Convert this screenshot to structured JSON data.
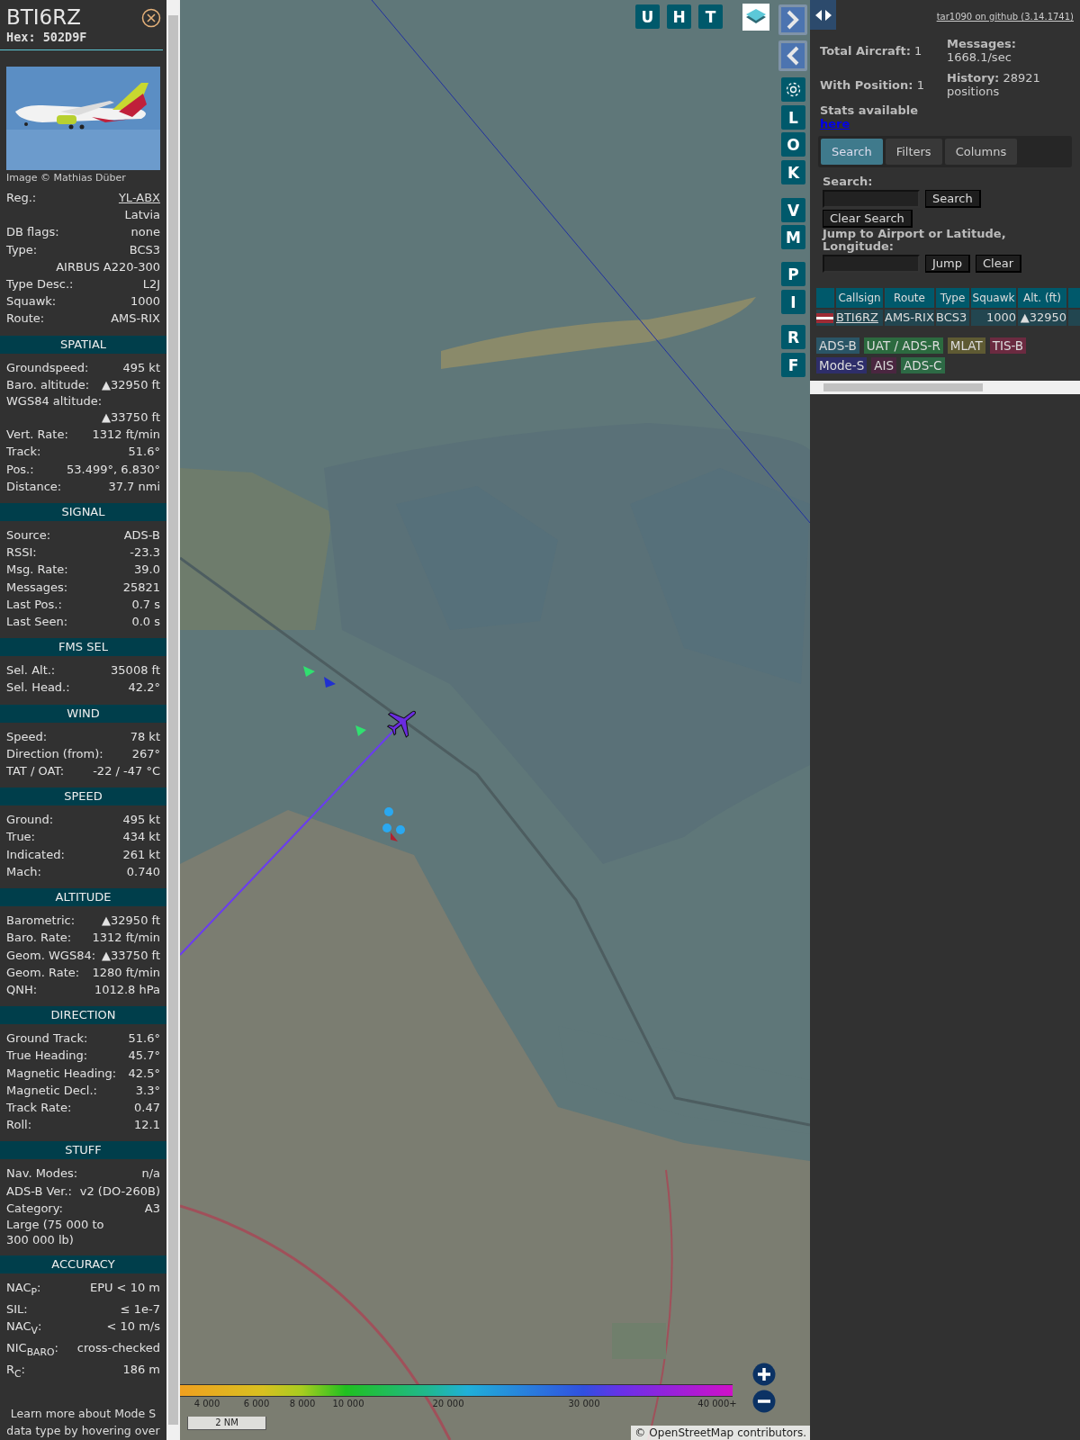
{
  "aircraft_panel": {
    "callsign": "BTI6RZ",
    "hex": "Hex: 502D9F",
    "photo_credit": "Image © Mathias Düber",
    "info_rows": [
      {
        "kind": "link",
        "label": "Reg.:",
        "value": "YL-ABX"
      },
      {
        "kind": "value",
        "value": "Latvia"
      },
      {
        "kind": "pair",
        "label": "DB flags:",
        "value": "none"
      },
      {
        "kind": "pair",
        "label": "Type:",
        "value": "BCS3"
      },
      {
        "kind": "value",
        "value": "AIRBUS A220-300"
      },
      {
        "kind": "pair",
        "label": "Type Desc.:",
        "value": "L2J"
      },
      {
        "kind": "pair",
        "label": "Squawk:",
        "value": "1000"
      },
      {
        "kind": "pair",
        "label": "Route:",
        "value": "AMS-RIX"
      }
    ],
    "sections": [
      {
        "title": "SPATIAL",
        "rows": [
          {
            "kind": "pair",
            "label": "Groundspeed:",
            "value": "495 kt"
          },
          {
            "kind": "pair",
            "label": "Baro. altitude:",
            "value": "▲32950 ft"
          },
          {
            "kind": "label",
            "label": "WGS84 altitude:"
          },
          {
            "kind": "value",
            "value": "▲33750 ft"
          },
          {
            "kind": "pair",
            "label": "Vert. Rate:",
            "value": "1312 ft/min"
          },
          {
            "kind": "pair",
            "label": "Track:",
            "value": "51.6°"
          },
          {
            "kind": "pair",
            "label": "Pos.:",
            "value": "53.499°, 6.830°"
          },
          {
            "kind": "pair",
            "label": "Distance:",
            "value": "37.7 nmi"
          }
        ]
      },
      {
        "title": "SIGNAL",
        "rows": [
          {
            "kind": "pair",
            "label": "Source:",
            "value": "ADS-B"
          },
          {
            "kind": "pair",
            "label": "RSSI:",
            "value": "-23.3"
          },
          {
            "kind": "pair",
            "label": "Msg. Rate:",
            "value": "39.0"
          },
          {
            "kind": "pair",
            "label": "Messages:",
            "value": "25821"
          },
          {
            "kind": "pair",
            "label": "Last Pos.:",
            "value": "0.7 s"
          },
          {
            "kind": "pair",
            "label": "Last Seen:",
            "value": "0.0 s"
          }
        ]
      },
      {
        "title": "FMS SEL",
        "rows": [
          {
            "kind": "pair",
            "label": "Sel. Alt.:",
            "value": "35008 ft"
          },
          {
            "kind": "pair",
            "label": "Sel. Head.:",
            "value": "42.2°"
          }
        ]
      },
      {
        "title": "WIND",
        "rows": [
          {
            "kind": "pair",
            "label": "Speed:",
            "value": "78 kt"
          },
          {
            "kind": "pair",
            "label": "Direction (from):",
            "value": "267°"
          },
          {
            "kind": "pair",
            "label": "TAT / OAT:",
            "value": "-22 / -47 °C"
          }
        ]
      },
      {
        "title": "SPEED",
        "rows": [
          {
            "kind": "pair",
            "label": "Ground:",
            "value": "495 kt"
          },
          {
            "kind": "pair",
            "label": "True:",
            "value": "434 kt"
          },
          {
            "kind": "pair",
            "label": "Indicated:",
            "value": "261 kt"
          },
          {
            "kind": "pair",
            "label": "Mach:",
            "value": "0.740"
          }
        ]
      },
      {
        "title": "ALTITUDE",
        "rows": [
          {
            "kind": "pair",
            "label": "Barometric:",
            "value": "▲32950 ft"
          },
          {
            "kind": "pair",
            "label": "Baro. Rate:",
            "value": "1312 ft/min"
          },
          {
            "kind": "pair",
            "label": "Geom. WGS84:",
            "value": "▲33750 ft"
          },
          {
            "kind": "pair",
            "label": "Geom. Rate:",
            "value": "1280 ft/min"
          },
          {
            "kind": "pair",
            "label": "QNH:",
            "value": "1012.8 hPa"
          }
        ]
      },
      {
        "title": "DIRECTION",
        "rows": [
          {
            "kind": "pair",
            "label": "Ground Track:",
            "value": "51.6°"
          },
          {
            "kind": "pair",
            "label": "True Heading:",
            "value": "45.7°"
          },
          {
            "kind": "pair",
            "label": "Magnetic Heading:",
            "value": "42.5°"
          },
          {
            "kind": "pair",
            "label": "Magnetic Decl.:",
            "value": "3.3°"
          },
          {
            "kind": "pair",
            "label": "Track Rate:",
            "value": "0.47"
          },
          {
            "kind": "pair",
            "label": "Roll:",
            "value": "12.1"
          }
        ]
      },
      {
        "title": "STUFF",
        "rows": [
          {
            "kind": "pair",
            "label": "Nav. Modes:",
            "value": "n/a"
          },
          {
            "kind": "pair",
            "label": "ADS-B Ver.:",
            "value": "v2 (DO-260B)"
          },
          {
            "kind": "pair",
            "label": "Category:",
            "value": "A3"
          },
          {
            "kind": "label",
            "label": "Large (75 000 to 300 000 lb)"
          }
        ]
      },
      {
        "title": "ACCURACY",
        "rows": [
          {
            "kind": "pair",
            "label": "NAC$_{P}$:",
            "value": "EPU < 10 m"
          },
          {
            "kind": "pair",
            "label": "SIL:",
            "value": "≤ 1e-7"
          },
          {
            "kind": "pair",
            "label": "NAC$_{V}$:",
            "value": "< 10 m/s"
          },
          {
            "kind": "pair",
            "label": "NIC$_{BARO}$:",
            "value": "cross-checked"
          },
          {
            "kind": "pair",
            "label": "R$_{C}$:",
            "value": "186 m"
          }
        ]
      }
    ],
    "footer": "Learn more about Mode S data type by hovering over"
  },
  "map": {
    "top_buttons": [
      "U",
      "H",
      "T"
    ],
    "side_buttons": [
      "L",
      "O",
      "K",
      "V",
      "M",
      "P",
      "I",
      "R",
      "F"
    ],
    "altitude_legend": [
      "4 000",
      "6 000",
      "8 000",
      "10 000",
      "20 000",
      "30 000",
      "40 000+"
    ],
    "scale": "2 NM",
    "attribution": {
      "before": "©",
      "link": "OpenStreetMap",
      "after": "contributors."
    }
  },
  "sidebar": {
    "github_link": "tar1090 on github (3.14.1741)",
    "stats": [
      "**Total Aircraft:** 1",
      "**With Position:** 1",
      "**Messages:** 1668.1/sec",
      "**History:** 28921 positions"
    ],
    "stats_note": "Stats available",
    "stats_link": "here",
    "tabs": [
      {
        "label": "Search",
        "selected": true
      },
      {
        "label": "Filters",
        "selected": false
      },
      {
        "label": "Columns",
        "selected": false
      }
    ],
    "search": {
      "label": "Search:",
      "search_button": "Search",
      "clear_button": "Clear Search",
      "jump_label": "Jump to Airport or Latitude, Longitude:",
      "jump_button": "Jump",
      "jump_clear_button": "Clear"
    },
    "table": {
      "columns": [
        "Callsign",
        "Route",
        "Type",
        "Squawk",
        "Alt. (ft)"
      ],
      "rows": [
        {
          "cells": [
            "BTI6RZ",
            "AMS-RIX",
            "BCS3",
            "1000",
            "▲32950"
          ]
        }
      ]
    },
    "source_legend": [
      {
        "label": "ADS-B",
        "color": "#2a5566"
      },
      {
        "label": "UAT / ADS-R",
        "color": "#2c6a3f"
      },
      {
        "label": "MLAT",
        "color": "#5e5a33"
      },
      {
        "label": "TIS-B",
        "color": "#6b2a40"
      },
      {
        "label": "Mode-S",
        "color": "#2e2e6a"
      },
      {
        "label": "AIS",
        "color": "#4a2640"
      },
      {
        "label": "ADS-C",
        "color": "#2d6a45"
      }
    ]
  }
}
